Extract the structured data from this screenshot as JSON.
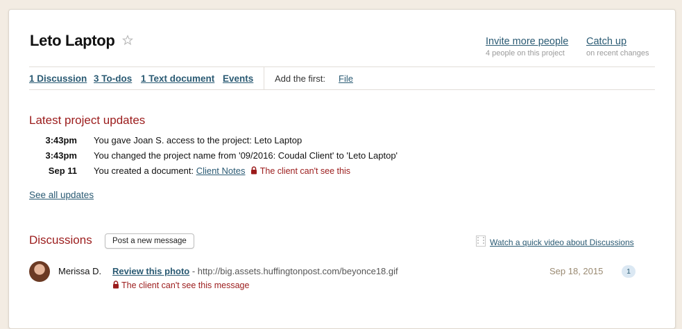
{
  "project": {
    "title": "Leto Laptop"
  },
  "header_links": {
    "invite": {
      "label": "Invite more people",
      "sub": "4 people on this project"
    },
    "catchup": {
      "label": "Catch up",
      "sub": "on recent changes"
    }
  },
  "nav": {
    "discussion": "1 Discussion",
    "todos": "3 To-dos",
    "text_document": "1 Text document",
    "events": "Events",
    "add_first_label": "Add the first:",
    "file": "File"
  },
  "updates": {
    "title": "Latest project updates",
    "items": [
      {
        "time": "3:43pm",
        "text": "You gave Joan S. access to the project: Leto Laptop"
      },
      {
        "time": "3:43pm",
        "text": "You changed the project name from '09/2016: Coudal Client' to 'Leto Laptop'"
      },
      {
        "time": "Sep 11",
        "text_prefix": "You created a document: ",
        "link": "Client Notes",
        "note": "The client can't see this"
      }
    ],
    "see_all": "See all updates"
  },
  "discussions": {
    "title": "Discussions",
    "post_button": "Post a new message",
    "video_link": "Watch a quick video about Discussions",
    "items": [
      {
        "author": "Merissa D.",
        "subject": "Review this photo",
        "excerpt": " - http://big.assets.huffingtonpost.com/beyonce18.gif",
        "privacy": "The client can't see this message",
        "date": "Sep 18, 2015",
        "count": "1"
      }
    ]
  },
  "colors": {
    "accent_red": "#9b1b1b",
    "link_blue": "#2a5a73",
    "background": "#f3ece3"
  },
  "icons": [
    "star-icon",
    "lock-icon",
    "film-icon"
  ]
}
